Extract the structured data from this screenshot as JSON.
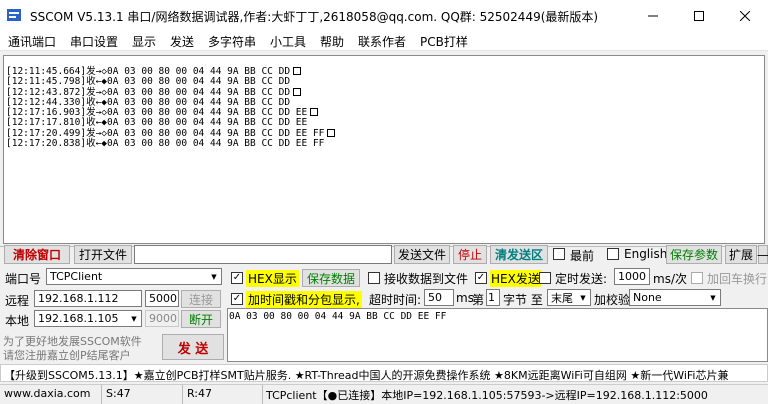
{
  "window": {
    "title": "SSCOM V5.13.1 串口/网络数据调试器,作者:大虾丁丁,2618058@qq.com. QQ群: 52502449(最新版本)"
  },
  "menu": [
    "通讯端口",
    "串口设置",
    "显示",
    "发送",
    "多字符串",
    "小工具",
    "帮助",
    "联系作者",
    "PCB打样"
  ],
  "log": [
    {
      "ts": "[12:11:45.664]",
      "dir": "发→◇",
      "data": "0A 03 00 80 00 04 44 9A BB CC DD",
      "box": true
    },
    {
      "ts": "[12:11:45.798]",
      "dir": "收←◆",
      "data": "0A 03 00 80 00 04 44 9A BB CC DD",
      "box": false
    },
    {
      "ts": "[12:12:43.872]",
      "dir": "发→◇",
      "data": "0A 03 00 80 00 04 44 9A BB CC DD",
      "box": true
    },
    {
      "ts": "[12:12:44.330]",
      "dir": "收←◆",
      "data": "0A 03 00 80 00 04 44 9A BB CC DD",
      "box": false
    },
    {
      "ts": "[12:17:16.903]",
      "dir": "发→◇",
      "data": "0A 03 00 80 00 04 44 9A BB CC DD EE",
      "box": true
    },
    {
      "ts": "[12:17:17.810]",
      "dir": "收←◆",
      "data": "0A 03 00 80 00 04 44 9A BB CC DD EE",
      "box": false
    },
    {
      "ts": "[12:17:20.499]",
      "dir": "发→◇",
      "data": "0A 03 00 80 00 04 44 9A BB CC DD EE FF",
      "box": true
    },
    {
      "ts": "[12:17:20.838]",
      "dir": "收←◆",
      "data": "0A 03 00 80 00 04 44 9A BB CC DD EE FF",
      "box": false
    }
  ],
  "toolbar": {
    "clear": "清除窗口",
    "open_file": "打开文件",
    "send_file": "发送文件",
    "stop": "停止",
    "clear_send": "清发送区",
    "front": "最前",
    "english": "English",
    "save_params": "保存参数",
    "expand": "扩展",
    "collapse": "—"
  },
  "conn": {
    "port_label": "端口号",
    "port_value": "TCPClient",
    "remote_label": "远程",
    "remote_ip": "192.168.1.112",
    "remote_port": "5000",
    "connect": "连接",
    "local_label": "本地",
    "local_ip": "192.168.1.105",
    "local_port": "9000",
    "disconnect": "断开"
  },
  "opts": {
    "hex_display": "HEX显示",
    "save_data": "保存数据",
    "recv_to_file": "接收数据到文件",
    "hex_send": "HEX发送",
    "timed_send": "定时发送:",
    "interval": "1000",
    "interval_unit": "ms/次",
    "add_crlf": "加回车换行",
    "timestamp": "加时间戳和分包显示,",
    "timeout_label": "超时时间:",
    "timeout": "50",
    "timeout_unit": "ms",
    "nth": "第",
    "byte_n": "1",
    "byte_word": "字节 至",
    "end_opt": "末尾",
    "checksum_label": "加校验",
    "checksum": "None"
  },
  "promo": {
    "line1": "为了更好地发展SSCOM软件",
    "line2": "请您注册嘉立创P结尾客户"
  },
  "send": {
    "button": "发 送",
    "content": "0A 03 00 80 00 04 44 9A BB CC DD EE FF"
  },
  "ticker": "【升级到SSCOM5.13.1】★嘉立创PCB打样SMT贴片服务. ★RT-Thread中国人的开源免费操作系统 ★8KM远距离WiFi可自组网 ★新一代WiFi芯片兼",
  "status": {
    "site": "www.daxia.com",
    "sent": "S:47",
    "recv": "R:47",
    "conn": "TCPclient【●已连接】本地IP=192.168.1.105:57593->远程IP=192.168.1.112:5000"
  },
  "colors": {
    "accent_red": "#c00000",
    "accent_green": "#008000",
    "highlight": "#ffff00"
  }
}
